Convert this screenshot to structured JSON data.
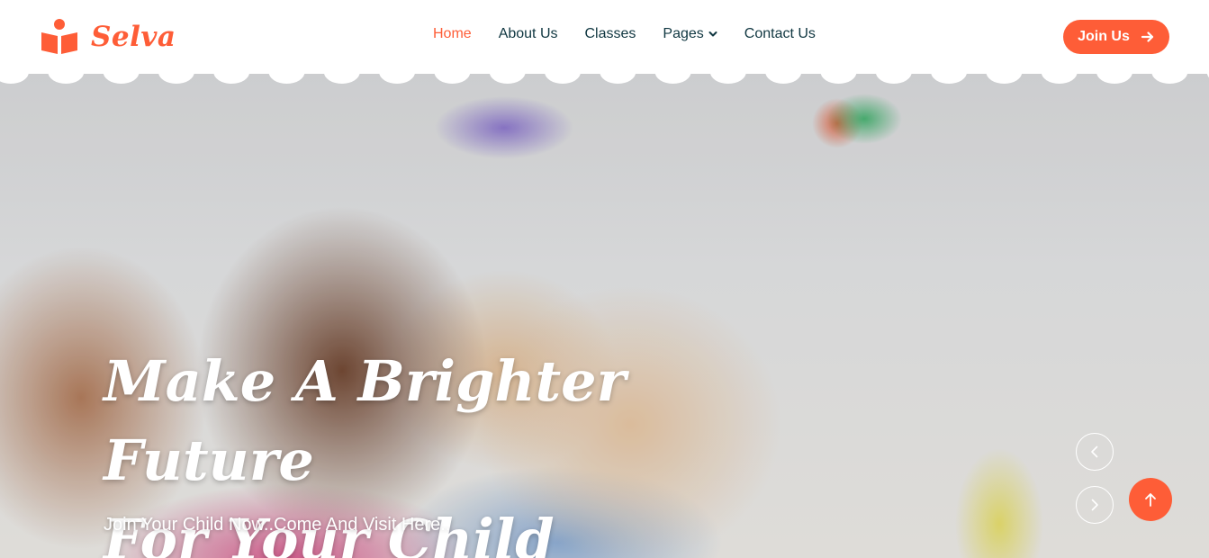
{
  "brand": {
    "name": "Selva",
    "accent_color": "#fe5d37",
    "text_color": "#103741",
    "logo_icon": "book-reader-icon"
  },
  "nav": {
    "items": [
      {
        "label": "Home",
        "active": true
      },
      {
        "label": "About Us",
        "active": false
      },
      {
        "label": "Classes",
        "active": false
      },
      {
        "label": "Pages",
        "active": false,
        "dropdown": true
      },
      {
        "label": "Contact Us",
        "active": false
      }
    ]
  },
  "header": {
    "join_label": "Join Us",
    "join_icon": "arrow-right-icon"
  },
  "hero": {
    "title_line1": "Make A Brighter Future",
    "title_line2": "For Your Child",
    "subtitle": "Join Your Child Now..Come And Visit Here..",
    "prev_icon": "chevron-left-icon",
    "next_icon": "chevron-right-icon"
  },
  "back_to_top": {
    "icon": "arrow-up-icon"
  }
}
